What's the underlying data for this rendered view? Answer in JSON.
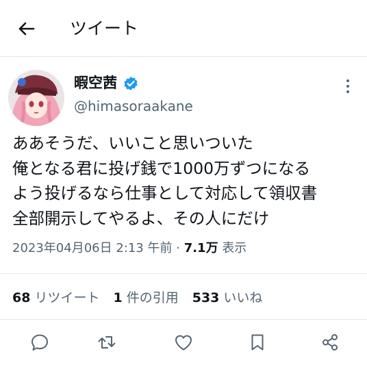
{
  "header": {
    "title": "ツイート",
    "back_icon": "back-arrow-icon"
  },
  "author": {
    "name": "暇空茜",
    "handle": "@himasoraakane",
    "verified": true,
    "verified_color": "#1d9bf0"
  },
  "tweet": {
    "lines": [
      "ああそうだ、いいこと思いついた",
      "俺となる君に投げ銭で1000万ずつになる",
      "よう投げるなら仕事として対応して領収書",
      "全部開示してやるよ、その人にだけ"
    ]
  },
  "meta": {
    "timestamp": "2023年04月06日 2:13 午前",
    "separator": "·",
    "views_count": "7.1万",
    "views_label": "表示"
  },
  "stats": {
    "retweets_count": "68",
    "retweets_label": "リツイート",
    "quotes_count": "1",
    "quotes_label": "件の引用",
    "likes_count": "533",
    "likes_label": "いいね"
  },
  "actions": [
    "reply-icon",
    "retweet-icon",
    "like-icon",
    "bookmark-icon",
    "share-icon"
  ],
  "colors": {
    "text": "#0f1419",
    "secondary": "#536471",
    "divider": "#e3e6e9"
  }
}
